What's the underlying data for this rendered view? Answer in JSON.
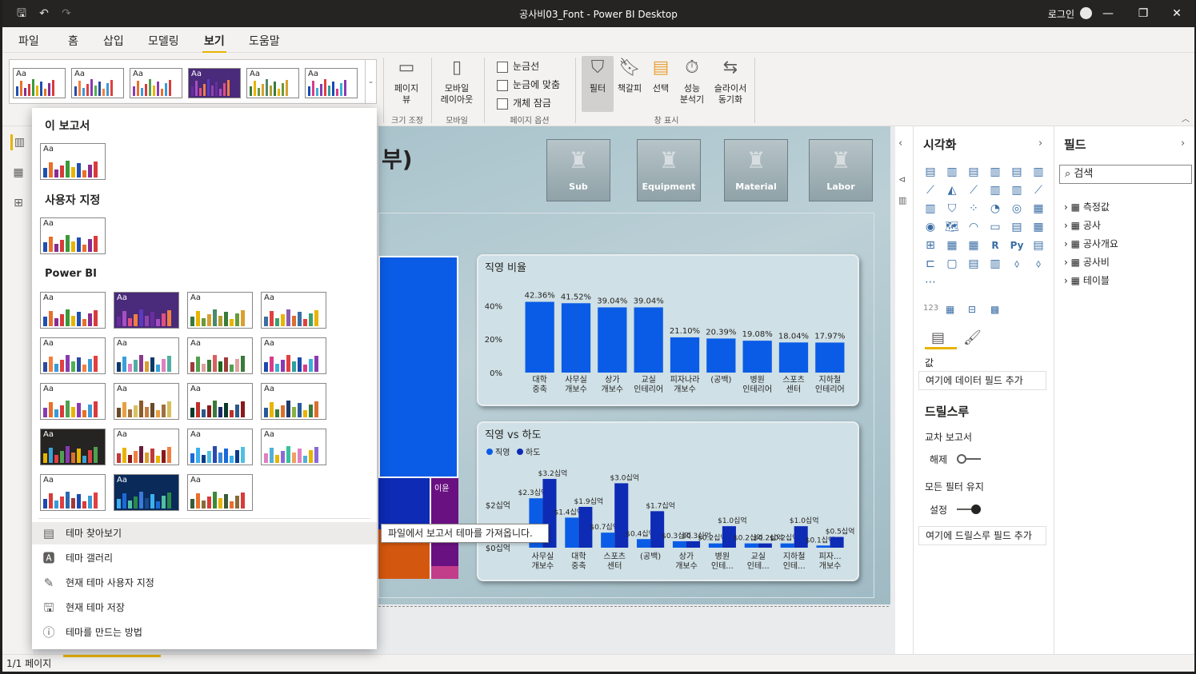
{
  "window": {
    "title": "공사비03_Font - Power BI Desktop",
    "login": "로그인"
  },
  "menu": [
    "파일",
    "홈",
    "삽입",
    "모델링",
    "보기",
    "도움말"
  ],
  "menu_active": "보기",
  "ribbon": {
    "page_view": "페이지\n뷰",
    "mobile_layout": "모바일\n레이아웃",
    "gridlines": "눈금선",
    "snap_to_grid": "눈금에 맞춤",
    "lock_objects": "개체 잠금",
    "filter": "필터",
    "bookmarks": "책갈피",
    "selection": "선택",
    "performance": "성능\n분석기",
    "sync_slicers": "슬라이서\n동기화",
    "groups": {
      "scale": "크기 조정",
      "mobile": "모바일",
      "page_options": "페이지 옵션",
      "show_panes": "창 표시"
    }
  },
  "theme_dropdown": {
    "this_report": "이 보고서",
    "custom": "사용자 지정",
    "powerbi": "Power BI",
    "thumb_text": "Aa",
    "items": [
      {
        "label": "테마 찾아보기",
        "icon": "browse-theme-icon"
      },
      {
        "label": "테마 갤러리",
        "icon": "theme-gallery-icon"
      },
      {
        "label": "현재 테마 사용자 지정",
        "icon": "customize-theme-icon"
      },
      {
        "label": "현재 테마 저장",
        "icon": "save-theme-icon"
      },
      {
        "label": "테마를 만드는 방법",
        "icon": "help-icon"
      }
    ],
    "tooltip": "파일에서 보고서 테마를 가져옵니다."
  },
  "report": {
    "title_fragment": "부)",
    "buttons": [
      "Sub",
      "Equipment",
      "Material",
      "Labor"
    ],
    "treemap_label": "이윤"
  },
  "viz_pane": {
    "title": "시각화",
    "values_label": "값",
    "add_data_field": "여기에 데이터 필드 추가",
    "drillthrough": "드릴스루",
    "cross_report": "교차 보고서",
    "cross_report_state": "해제",
    "keep_all_filters": "모든 필터 유지",
    "keep_all_filters_state": "설정",
    "add_drillthrough": "여기에 드릴스루 필드 추가"
  },
  "fields_pane": {
    "title": "필드",
    "search_placeholder": "검색",
    "tables": [
      "측정값",
      "공사",
      "공사개요",
      "공사비",
      "테이블"
    ]
  },
  "status": {
    "page": "1/1 페이지"
  },
  "colors": {
    "accent": "#e8b400",
    "bar_blue": "#0a5ce6",
    "bar_navy": "#0d2bb5"
  },
  "chart_data": [
    {
      "type": "bar",
      "title": "직영 비율",
      "categories": [
        "대학\n중축",
        "사무실\n개보수",
        "상가\n개보수",
        "교실\n인테리어",
        "피자나라\n개보수",
        "(공백)",
        "병원\n인테리어",
        "스포츠\n센터",
        "지하철\n인테리어"
      ],
      "values": [
        42.36,
        41.52,
        39.04,
        39.04,
        21.1,
        20.39,
        19.08,
        18.04,
        17.97
      ],
      "data_labels": [
        "42.36%",
        "41.52%",
        "39.04%",
        "39.04%",
        "21.10%",
        "20.39%",
        "19.08%",
        "18.04%",
        "17.97%"
      ],
      "yticks": [
        "0%",
        "20%",
        "40%"
      ],
      "ylim": [
        0,
        45
      ]
    },
    {
      "type": "bar",
      "title": "직영 vs 하도",
      "categories": [
        "사무실\n개보수",
        "대학\n중축",
        "스포츠\n센터",
        "(공백)",
        "상가\n개보수",
        "병원\n인테...",
        "교실\n인테...",
        "지하철\n인테...",
        "피자...\n개보수"
      ],
      "series": [
        {
          "name": "직영",
          "values": [
            2.3,
            1.4,
            0.7,
            0.4,
            0.3,
            0.2,
            0.2,
            0.2,
            0.1
          ],
          "labels": [
            "$2.3십억",
            "$1.4십억",
            "$0.7십억",
            "$0.4십억",
            "$0.3십억",
            "$0.2십억",
            "$0.2십억",
            "$0.2십억",
            "$0.1십억"
          ]
        },
        {
          "name": "하도",
          "values": [
            3.2,
            1.9,
            3.0,
            1.7,
            0.3,
            1.0,
            0.2,
            1.0,
            0.5
          ],
          "labels": [
            "$3.2십억",
            "$1.9십억",
            "$3.0십억",
            "$1.7십억",
            "$0.3십억",
            "$1.0십억",
            "$0.2십억",
            "$1.0십억",
            "$0.5십억"
          ]
        }
      ],
      "yticks": [
        "$0십억",
        "$2십억"
      ],
      "ylim": [
        0,
        3.5
      ],
      "legend": "top-left"
    }
  ]
}
